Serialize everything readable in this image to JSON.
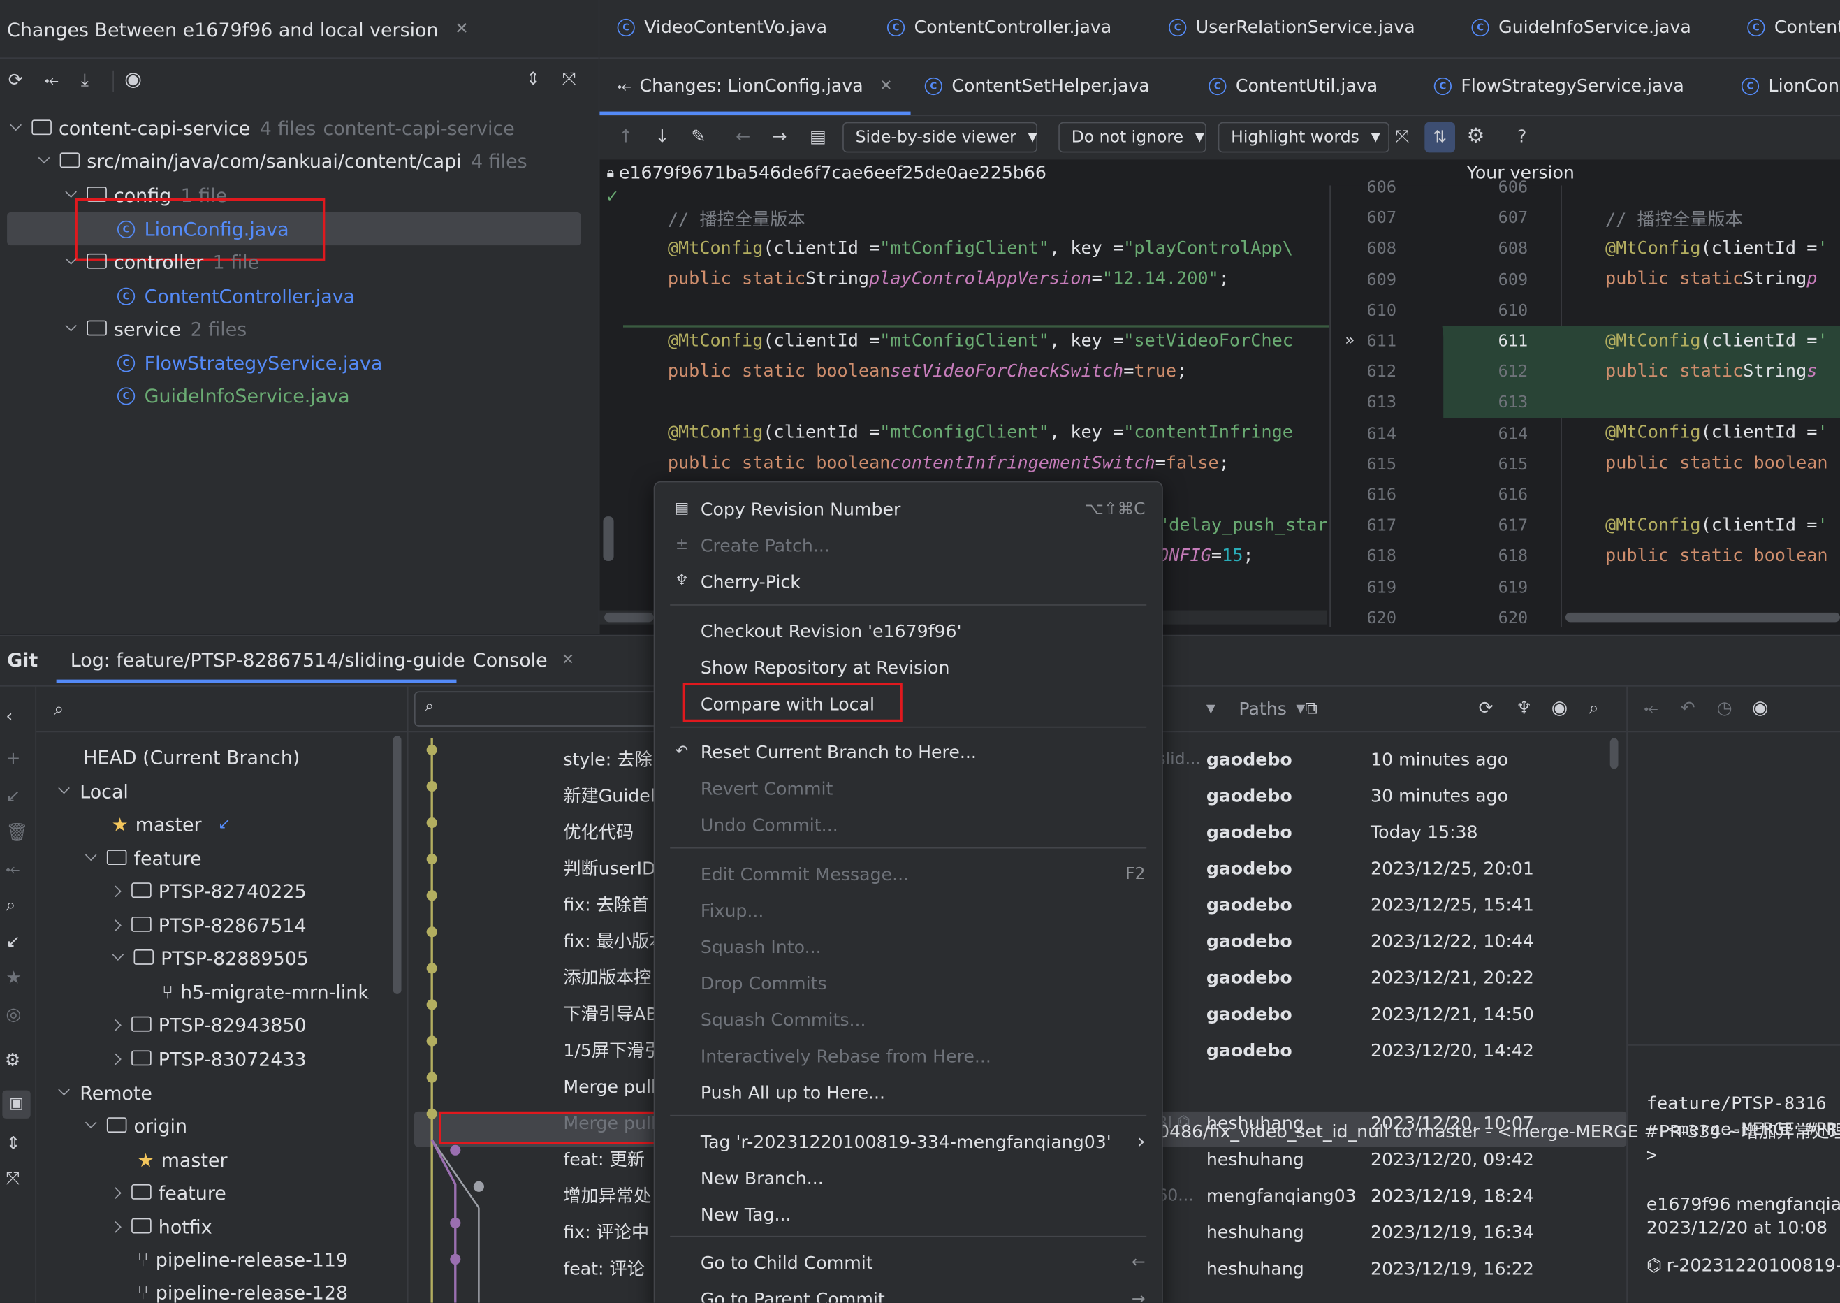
{
  "changes_panel": {
    "title": "Changes Between e1679f96 and local version",
    "tree": [
      {
        "label": "content-capi-service",
        "count": "4 files",
        "extra": "content-capi-service"
      },
      {
        "label": "src/main/java/com/sankuai/content/capi",
        "count": "4 files"
      },
      {
        "label": "config",
        "count": "1 file"
      },
      {
        "label": "LionConfig.java"
      },
      {
        "label": "controller",
        "count": "1 file"
      },
      {
        "label": "ContentController.java"
      },
      {
        "label": "service",
        "count": "2 files"
      },
      {
        "label": "FlowStrategyService.java"
      },
      {
        "label": "GuideInfoService.java"
      }
    ]
  },
  "editor": {
    "tabs_row1": [
      "VideoContentVo.java",
      "ContentController.java",
      "UserRelationService.java",
      "GuideInfoService.java",
      "Content"
    ],
    "tabs_row2": [
      "Changes: LionConfig.java",
      "ContentSetHelper.java",
      "ContentUtil.java",
      "FlowStrategyService.java",
      "LionCon"
    ],
    "viewer_mode": "Side-by-side viewer",
    "ignore_mode": "Do not ignore",
    "highlight_mode": "Highlight words",
    "help": "?",
    "left_revision": "e1679f9671ba546de6f7cae6eef25de0ae225b66",
    "right_title": "Your version",
    "left_lines": [
      "606",
      "607",
      "608",
      "609",
      "610",
      "611",
      "612",
      "613",
      "614",
      "615",
      "616",
      "617",
      "618",
      "619",
      "620"
    ],
    "right_lines": [
      "606",
      "607",
      "608",
      "609",
      "610",
      "611",
      "612",
      "613",
      "614",
      "615",
      "616",
      "617",
      "618",
      "619",
      "620"
    ],
    "code_left": {
      "c1": "// 播控全量版本",
      "c2a": "@MtConfig",
      "c2b": "(clientId = ",
      "c2c": "\"mtConfigClient\"",
      "c2d": ", key = ",
      "c2e": "\"playControlApp\\",
      "c3a": "public static ",
      "c3b": "String ",
      "c3c": "playControlAppVersion",
      "c3d": " = ",
      "c3e": "\"12.14.200\"",
      "c3f": ";",
      "c5e": "\"setVideoForChec",
      "c6a": "public static boolean ",
      "c6c": "setVideoForCheckSwitch",
      "c6d": " = ",
      "c6e": "true",
      "c6f": ";",
      "c8e": "\"contentInfringe",
      "c9c": "contentInfringementSwitch",
      "c9e": "false",
      "c11e": "\"delay_push_star",
      "c12c": "ONFIG",
      "c12d": " = ",
      "c12e": "15",
      "c12f": ";"
    },
    "code_right": {
      "r1": "// 播控全量版本",
      "r2a": "@MtConfig",
      "r2b": "(clientId = ",
      "r2c": "'",
      "r3a": "public static ",
      "r3b": "String ",
      "r3c": "p",
      "r6b": "String ",
      "r6c": "s",
      "r9a": "public static boolean"
    }
  },
  "git": {
    "tab_git": "Git",
    "tab_log": "Log: feature/PTSP-82867514/sliding-guide",
    "tab_console": "Console",
    "branches": [
      "HEAD (Current Branch)",
      "Local",
      "master",
      "feature",
      "PTSP-82740225",
      "PTSP-82867514",
      "PTSP-82889505",
      "h5-migrate-mrn-link",
      "PTSP-82943850",
      "PTSP-83072433",
      "Remote",
      "origin",
      "master",
      "feature",
      "hotfix",
      "pipeline-release-119",
      "pipeline-release-128"
    ],
    "filter_paths": "Paths",
    "commits": [
      {
        "msg": "style: 去除",
        "author": "gaodebo",
        "date": "10 minutes ago",
        "tag": "slid..."
      },
      {
        "msg": "新建Guidel",
        "author": "gaodebo",
        "date": "30 minutes ago"
      },
      {
        "msg": "优化代码",
        "author": "gaodebo",
        "date": "Today 15:38"
      },
      {
        "msg": "判断userID",
        "author": "gaodebo",
        "date": "2023/12/25, 20:01"
      },
      {
        "msg": "fix: 去除首",
        "author": "gaodebo",
        "date": "2023/12/25, 15:41"
      },
      {
        "msg": "fix: 最小版本",
        "author": "gaodebo",
        "date": "2023/12/22, 10:44"
      },
      {
        "msg": "添加版本控",
        "author": "gaodebo",
        "date": "2023/12/21, 20:22"
      },
      {
        "msg": "下滑引导AB",
        "author": "gaodebo",
        "date": "2023/12/21, 14:50"
      },
      {
        "msg": "1/5屏下滑引",
        "author": "gaodebo",
        "date": "2023/12/20, 14:42"
      },
      {
        "msg": "Merge pull",
        "author": "",
        "date": "",
        "tail": "0486/fix_video_set_id_null to master - <merge-MERGE #PR-334 ~增加异常处理 >"
      },
      {
        "msg": "Merge pull",
        "author": "heshuhang",
        "date": "2023/12/20, 10:07",
        "tag": "3I"
      },
      {
        "msg": "feat: 更新",
        "author": "heshuhang",
        "date": "2023/12/20, 09:42"
      },
      {
        "msg": "增加异常处",
        "author": "mengfanqiang03",
        "date": "2023/12/19, 18:24",
        "tag": "60..."
      },
      {
        "msg": "fix: 评论中",
        "author": "heshuhang",
        "date": "2023/12/19, 16:34"
      },
      {
        "msg": "feat: 评论",
        "author": "heshuhang",
        "date": "2023/12/19, 16:22"
      }
    ],
    "detail": {
      "l1": "feature/PTSP-8316",
      "l2": "- <merge-MERGE #PR",
      "l3": ">",
      "l4": "e1679f96 mengfanqia",
      "l5": "2023/12/20 at 10:08",
      "l6": "r-20231220100819-"
    }
  },
  "context_menu": {
    "items": [
      {
        "label": "Copy Revision Number",
        "shortcut": "⌥⇧⌘C",
        "icon": "▤",
        "disabled": false
      },
      {
        "label": "Create Patch...",
        "icon": "±",
        "disabled": true
      },
      {
        "label": "Cherry-Pick",
        "icon": "♆",
        "disabled": false
      },
      {
        "label": "Checkout Revision 'e1679f96'",
        "disabled": false
      },
      {
        "label": "Show Repository at Revision",
        "disabled": false
      },
      {
        "label": "Compare with Local",
        "disabled": false
      },
      {
        "label": "Reset Current Branch to Here...",
        "icon": "↶",
        "disabled": false
      },
      {
        "label": "Revert Commit",
        "disabled": true
      },
      {
        "label": "Undo Commit...",
        "disabled": true
      },
      {
        "label": "Edit Commit Message...",
        "shortcut": "F2",
        "disabled": true
      },
      {
        "label": "Fixup...",
        "disabled": true
      },
      {
        "label": "Squash Into...",
        "disabled": true
      },
      {
        "label": "Drop Commits",
        "disabled": true
      },
      {
        "label": "Squash Commits...",
        "disabled": true
      },
      {
        "label": "Interactively Rebase from Here...",
        "disabled": true
      },
      {
        "label": "Push All up to Here...",
        "disabled": false
      },
      {
        "label": "Tag 'r-20231220100819-334-mengfanqiang03'",
        "submenu": "›",
        "disabled": false
      },
      {
        "label": "New Branch...",
        "disabled": false
      },
      {
        "label": "New Tag...",
        "disabled": false
      },
      {
        "label": "Go to Child Commit",
        "shortcut": "←",
        "disabled": false
      },
      {
        "label": "Go to Parent Commit",
        "shortcut": "→",
        "disabled": false
      }
    ]
  },
  "colors": {
    "accent": "#548af7",
    "highlight_box": "#e0191e",
    "graph_yellow": "#b3ae60",
    "graph_purple": "#9a6fb0",
    "added_green": "#294436"
  }
}
